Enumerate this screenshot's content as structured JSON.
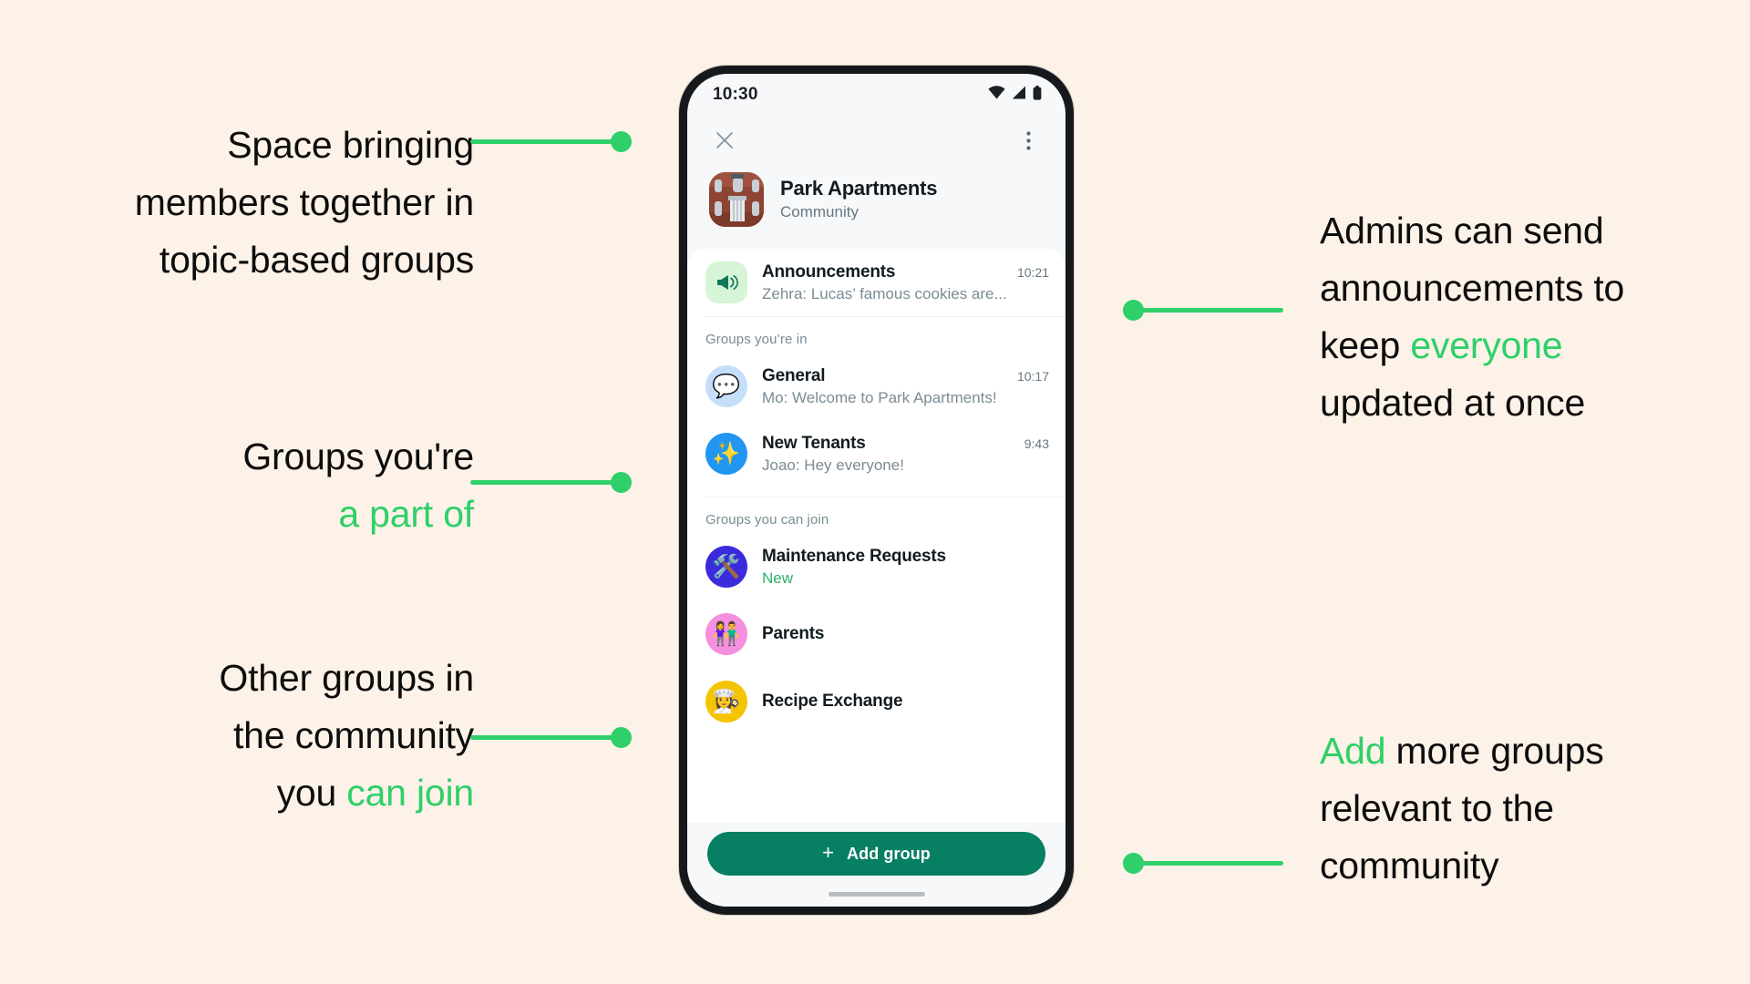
{
  "theme": {
    "background": "#fcf2e8",
    "accent_green": "#2fcf6a",
    "button_green": "#067f63",
    "new_badge_green": "#29b06a"
  },
  "phone": {
    "status_bar": {
      "time": "10:30",
      "icons": [
        "wifi-icon",
        "cellular-signal-icon",
        "battery-icon"
      ]
    },
    "top_bar": {
      "close_icon": "close-icon",
      "overflow_icon": "more-vertical-icon"
    },
    "community": {
      "avatar": "brick-apartment-building-photo",
      "name": "Park Apartments",
      "subtitle": "Community"
    },
    "announcement": {
      "icon": "megaphone-icon",
      "title": "Announcements",
      "time": "10:21",
      "preview": "Zehra: Lucas’ famous cookies are..."
    },
    "sections": [
      {
        "label": "Groups you’re in",
        "rows": [
          {
            "avatar_icon": "speech-balloon-emoji",
            "emoji": "💬",
            "title": "General",
            "time": "10:17",
            "subtitle": "Mo: Welcome to Park Apartments!",
            "subtitle_style": "muted",
            "avatar_class": "av-general"
          },
          {
            "avatar_icon": "sparkles-emoji",
            "emoji": "✨",
            "title": "New Tenants",
            "time": "9:43",
            "subtitle": "Joao: Hey everyone!",
            "subtitle_style": "muted",
            "avatar_class": "av-tenants"
          }
        ]
      },
      {
        "label": "Groups you can join",
        "rows": [
          {
            "avatar_icon": "hammer-and-wrench-emoji",
            "emoji": "🛠️",
            "title": "Maintenance Requests",
            "time": "",
            "subtitle": "New",
            "subtitle_style": "new",
            "avatar_class": "av-maint"
          },
          {
            "avatar_icon": "man-and-woman-holding-hands-emoji",
            "emoji": "👫",
            "title": "Parents",
            "time": "",
            "subtitle": "",
            "subtitle_style": "muted",
            "avatar_class": "av-parents"
          },
          {
            "avatar_icon": "cook-emoji",
            "emoji": "👩‍🍳",
            "title": "Recipe Exchange",
            "time": "",
            "subtitle": "",
            "subtitle_style": "muted",
            "avatar_class": "av-recipe"
          }
        ]
      }
    ],
    "footer": {
      "add_group_label": "Add group",
      "plus_icon": "plus-icon"
    }
  },
  "annotations": {
    "left": [
      {
        "lines": [
          [
            {
              "t": "Space bringing",
              "hl": false
            }
          ],
          [
            {
              "t": "members together in",
              "hl": false
            }
          ],
          [
            {
              "t": "topic-based groups",
              "hl": false
            }
          ]
        ]
      },
      {
        "lines": [
          [
            {
              "t": "Groups you're",
              "hl": false
            }
          ],
          [
            {
              "t": "a part of",
              "hl": true
            }
          ]
        ]
      },
      {
        "lines": [
          [
            {
              "t": "Other groups in",
              "hl": false
            }
          ],
          [
            {
              "t": "the community",
              "hl": false
            }
          ],
          [
            {
              "t": "you ",
              "hl": false
            },
            {
              "t": "can join",
              "hl": true
            }
          ]
        ]
      }
    ],
    "right": [
      {
        "lines": [
          [
            {
              "t": "Admins can send",
              "hl": false
            }
          ],
          [
            {
              "t": "announcements to",
              "hl": false
            }
          ],
          [
            {
              "t": "keep ",
              "hl": false
            },
            {
              "t": "everyone",
              "hl": true
            }
          ],
          [
            {
              "t": "updated at once",
              "hl": false
            }
          ]
        ]
      },
      {
        "lines": [
          [
            {
              "t": "Add",
              "hl": true
            },
            {
              "t": " more groups",
              "hl": false
            }
          ],
          [
            {
              "t": "relevant to the",
              "hl": false
            }
          ],
          [
            {
              "t": "community",
              "hl": false
            }
          ]
        ]
      }
    ]
  }
}
